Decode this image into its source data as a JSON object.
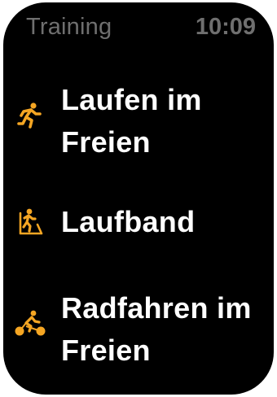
{
  "status_bar": {
    "title": "Training",
    "time": "10:09"
  },
  "colors": {
    "background": "#000000",
    "status_text": "#6f6f6f",
    "label_text": "#ffffff",
    "icon_accent": "#f5a623"
  },
  "menu": {
    "items": [
      {
        "label_line1": "Laufen im",
        "label_line2": "Freien",
        "icon": "outdoor-run-icon"
      },
      {
        "label_line1": "Laufband",
        "icon": "treadmill-icon"
      },
      {
        "label_line1": "Radfahren im",
        "label_line2": "Freien",
        "icon": "outdoor-cycle-icon"
      }
    ]
  }
}
